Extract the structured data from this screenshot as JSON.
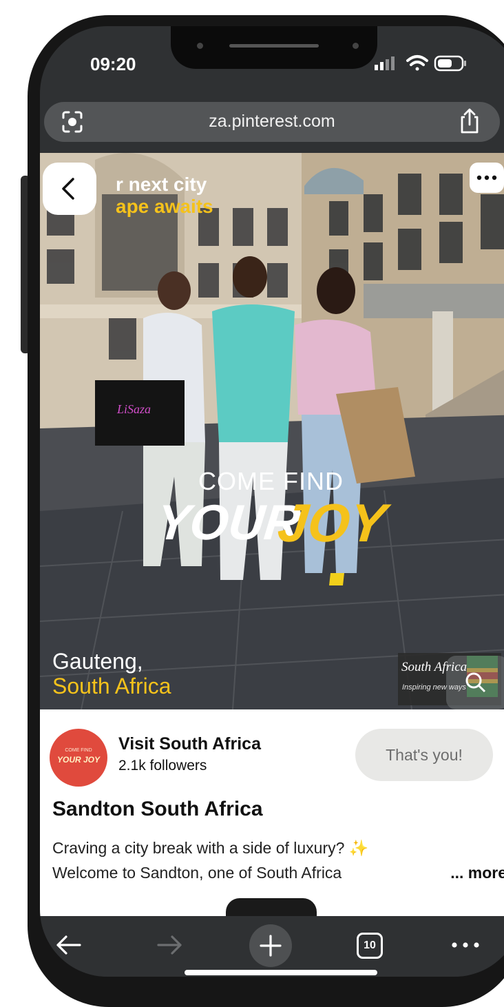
{
  "status_bar": {
    "time": "09:20"
  },
  "browser": {
    "url": "za.pinterest.com",
    "tab_count": "10"
  },
  "pin_image": {
    "headline_line1": "r next city",
    "headline_line2": "ape awaits",
    "slogan_top": "COME FIND",
    "slogan_bottom_left": "YOUR",
    "slogan_bottom_right": "JOY",
    "location_line1": "Gauteng,",
    "location_line2": "South Africa",
    "brand_logo_text": "South Africa",
    "brand_tagline": "Inspiring new ways",
    "bag_text": "LiSaza",
    "avatar_logo_top": "COME FIND",
    "avatar_logo_bottom": "YOUR JOY"
  },
  "profile": {
    "name": "Visit South Africa",
    "followers": "2.1k followers",
    "button_label": "That's you!"
  },
  "pin": {
    "title": "Sandton South Africa",
    "description_line1": "Craving a city break with a side of luxury? ✨",
    "description_line2": "Welcome to Sandton, one of South Africa",
    "more_label": "... more"
  },
  "icons": [
    "lens-icon",
    "share-icon",
    "back-icon",
    "more-options-icon",
    "arrow-left-icon",
    "arrow-right-icon",
    "plus-icon",
    "tabs-icon",
    "ellipsis-icon",
    "wifi-icon",
    "signal-icon",
    "battery-icon",
    "visual-search-icon"
  ],
  "colors": {
    "accent_yellow": "#f5c21b",
    "avatar_red": "#e04a3d",
    "button_gray": "#e8e8e6",
    "chrome_dark": "#2f3133"
  }
}
